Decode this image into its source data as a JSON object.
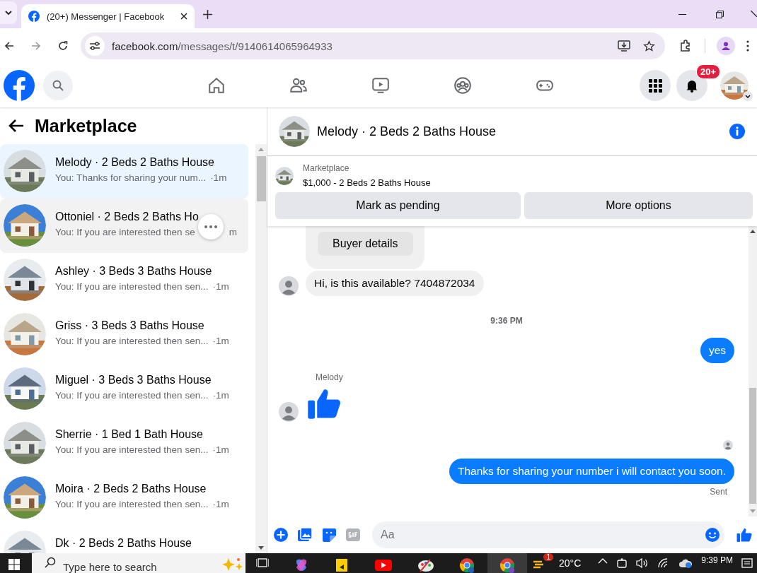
{
  "browser": {
    "tab_title": "(20+) Messenger | Facebook",
    "url_domain": "facebook.com",
    "url_path": "/messages/t/9140614065964933"
  },
  "header": {
    "notification_badge": "20+"
  },
  "sidebar": {
    "title": "Marketplace",
    "conversations": [
      {
        "name": "Melody · 2 Beds 2 Baths House",
        "preview": "You: Thanks for sharing your num...",
        "time": "·1m",
        "selected": true,
        "hovered": false
      },
      {
        "name": "Ottoniel · 2 Beds 2 Baths Ho",
        "preview": "You: If you are interested then se",
        "time": "m",
        "selected": false,
        "hovered": true
      },
      {
        "name": "Ashley · 3 Beds 3 Baths House",
        "preview": "You: If you are interested then sen...",
        "time": "·1m",
        "selected": false,
        "hovered": false
      },
      {
        "name": "Griss · 3 Beds 3 Baths House",
        "preview": "You: If you are interested then sen...",
        "time": "·1m",
        "selected": false,
        "hovered": false
      },
      {
        "name": "Miguel · 3 Beds 3 Baths House",
        "preview": "You: If you are interested then sen...",
        "time": "·1m",
        "selected": false,
        "hovered": false
      },
      {
        "name": "Sherrie · 1 Bed 1 Bath House",
        "preview": "You: If you are interested then sen...",
        "time": "·1m",
        "selected": false,
        "hovered": false
      },
      {
        "name": "Moira · 2 Beds 2 Baths House",
        "preview": "You: If you are interested then sen...",
        "time": "·1m",
        "selected": false,
        "hovered": false
      },
      {
        "name": "Dk · 2 Beds 2 Baths House",
        "selected": false,
        "hovered": false
      }
    ]
  },
  "chat": {
    "title": "Melody · 2 Beds 2 Baths House",
    "listing": {
      "label": "Marketplace",
      "price_title": "$1,000 - 2 Beds 2 Baths House",
      "buttons": [
        "Mark as pending",
        "More options"
      ]
    },
    "messages": [
      {
        "kind": "card",
        "button": "Buyer details"
      },
      {
        "kind": "incoming",
        "text": "Hi, is this available? 7404872034"
      },
      {
        "kind": "timestamp",
        "text": "9:36 PM"
      },
      {
        "kind": "outgoing",
        "text": "yes"
      },
      {
        "kind": "like",
        "sender": "Melody"
      },
      {
        "kind": "seen"
      },
      {
        "kind": "outgoing",
        "text": "Thanks for sharing your number i will contact you soon.",
        "status": "Sent"
      }
    ],
    "composer": {
      "placeholder": "Aa"
    }
  },
  "taskbar": {
    "search_placeholder": "Type here to search",
    "weather_badge": "1",
    "temperature": "20°C",
    "time": "9:39 PM"
  }
}
